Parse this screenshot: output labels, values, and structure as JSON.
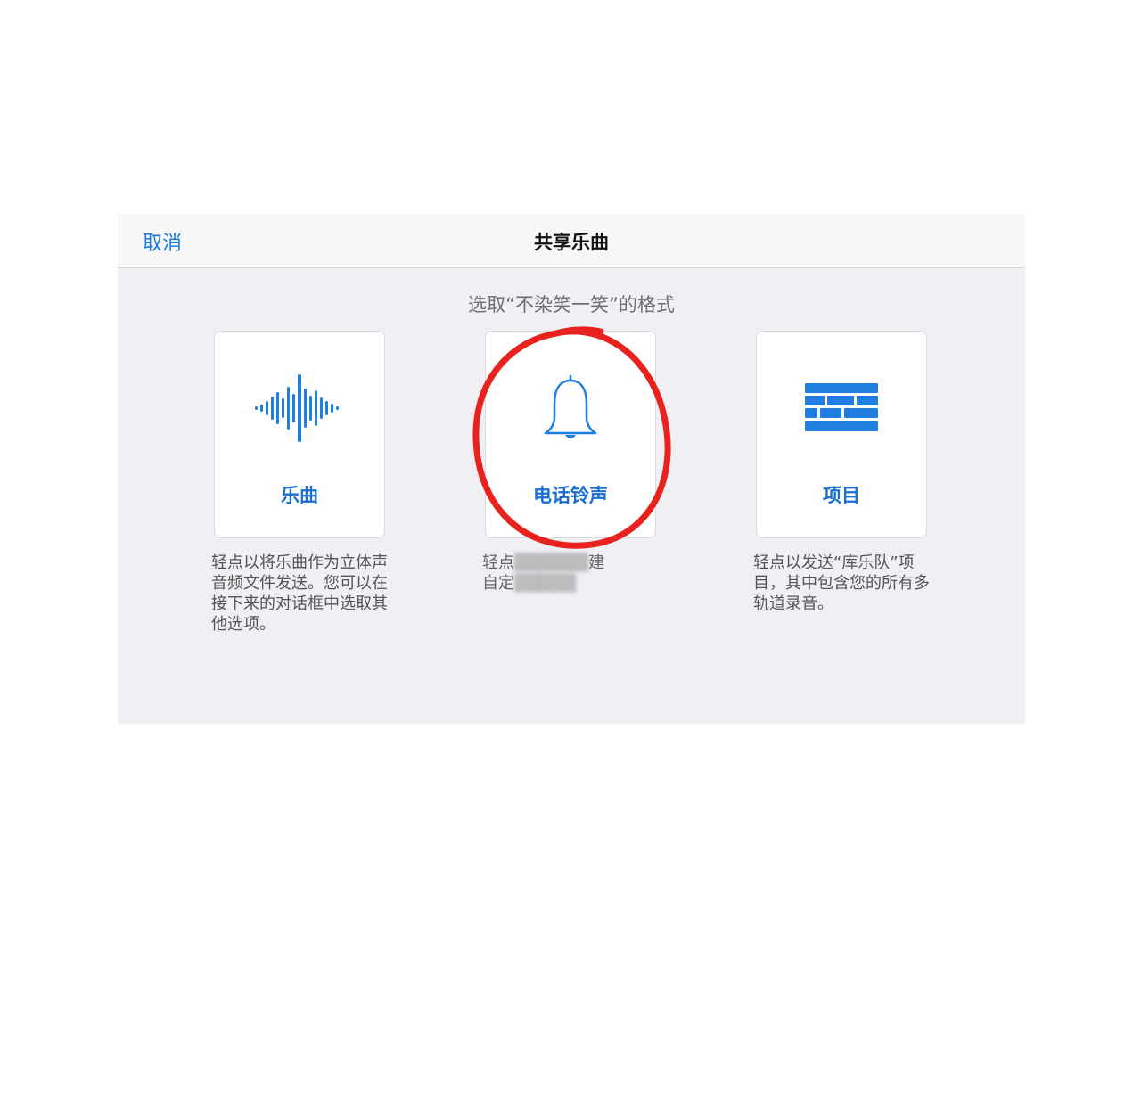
{
  "navbar": {
    "cancel_label": "取消",
    "title": "共享乐曲"
  },
  "subtitle": "选取“不染笑一笑”的格式",
  "options": [
    {
      "label": "乐曲",
      "icon": "waveform-icon",
      "description": "轻点以将乐曲作为立体声音频文件发送。您可以在接下来的对话框中选取其他选项。"
    },
    {
      "label": "电话铃声",
      "icon": "bell-icon",
      "description_visible_start": "轻点",
      "description_visible_end": "建",
      "description_line2_start": "自定"
    },
    {
      "label": "项目",
      "icon": "bricks-icon",
      "description": "轻点以发送“库乐队”项目，其中包含您的所有多轨道录音。"
    }
  ],
  "colors": {
    "accent": "#1a7ad6",
    "icon_blue": "#1f7ee0",
    "annotation_red": "#e8231e",
    "background": "#efeff4"
  }
}
